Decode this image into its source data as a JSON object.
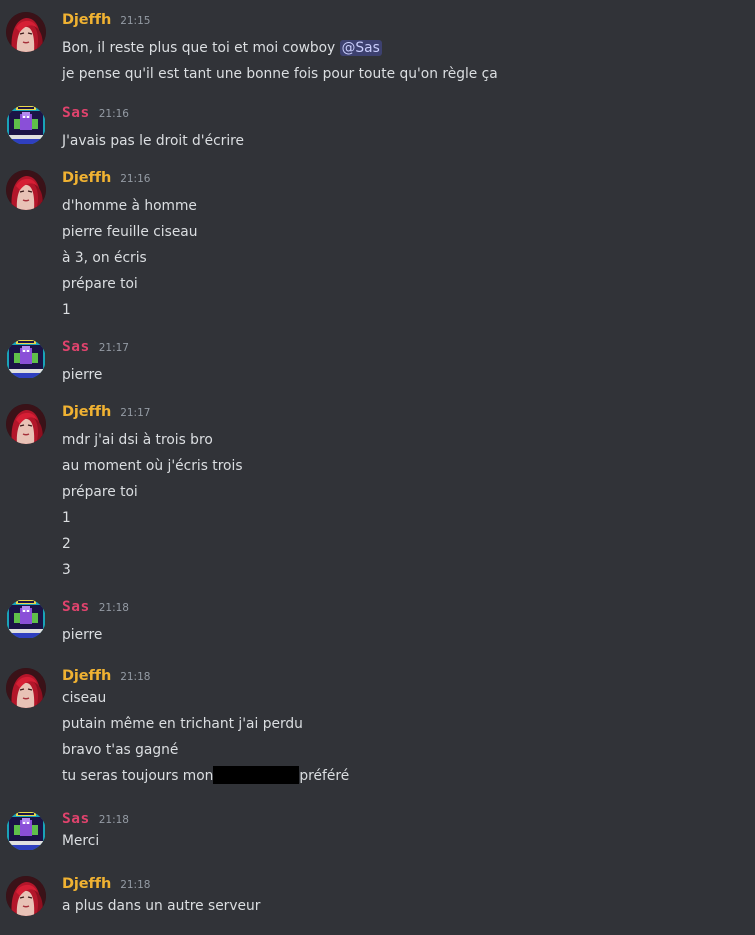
{
  "users": {
    "djeffh": {
      "name": "Djeffh",
      "color": "#f0b232",
      "avatar": "red-haired-woman-avatar"
    },
    "sas": {
      "name": "Sas",
      "color": "#e0436d",
      "avatar": "pixel-arcade-avatar"
    }
  },
  "groups": [
    {
      "author": "Djeffh",
      "time": "21:15",
      "lines": [
        "Bon, il reste plus que toi et moi cowboy",
        "je pense qu'il est tant une bonne fois pour toute qu'on règle ça"
      ],
      "mention": "@Sas"
    },
    {
      "author": "Sas",
      "time": "21:16",
      "lines": [
        "J'avais pas le droit d'écrire"
      ]
    },
    {
      "author": "Djeffh",
      "time": "21:16",
      "lines": [
        "d'homme à homme",
        "pierre feuille ciseau",
        "à 3, on écris",
        "prépare toi",
        "1"
      ]
    },
    {
      "author": "Sas",
      "time": "21:17",
      "lines": [
        "pierre"
      ]
    },
    {
      "author": "Djeffh",
      "time": "21:17",
      "lines": [
        "mdr j'ai dsi à trois bro",
        "au moment où j'écris trois",
        "prépare toi",
        "1",
        "2",
        "3"
      ]
    },
    {
      "author": "Sas",
      "time": "21:18",
      "lines": [
        "pierre"
      ]
    },
    {
      "author": "Djeffh",
      "time": "21:18",
      "lines": [
        "ciseau",
        "putain même en trichant j'ai perdu",
        "bravo t'as gagné",
        "tu seras toujours mon"
      ],
      "suffix": "préféré"
    },
    {
      "author": "Sas",
      "time": "21:18",
      "lines": [
        "Merci"
      ]
    },
    {
      "author": "Djeffh",
      "time": "21:18",
      "lines": [
        "a plus dans un autre serveur"
      ]
    }
  ]
}
